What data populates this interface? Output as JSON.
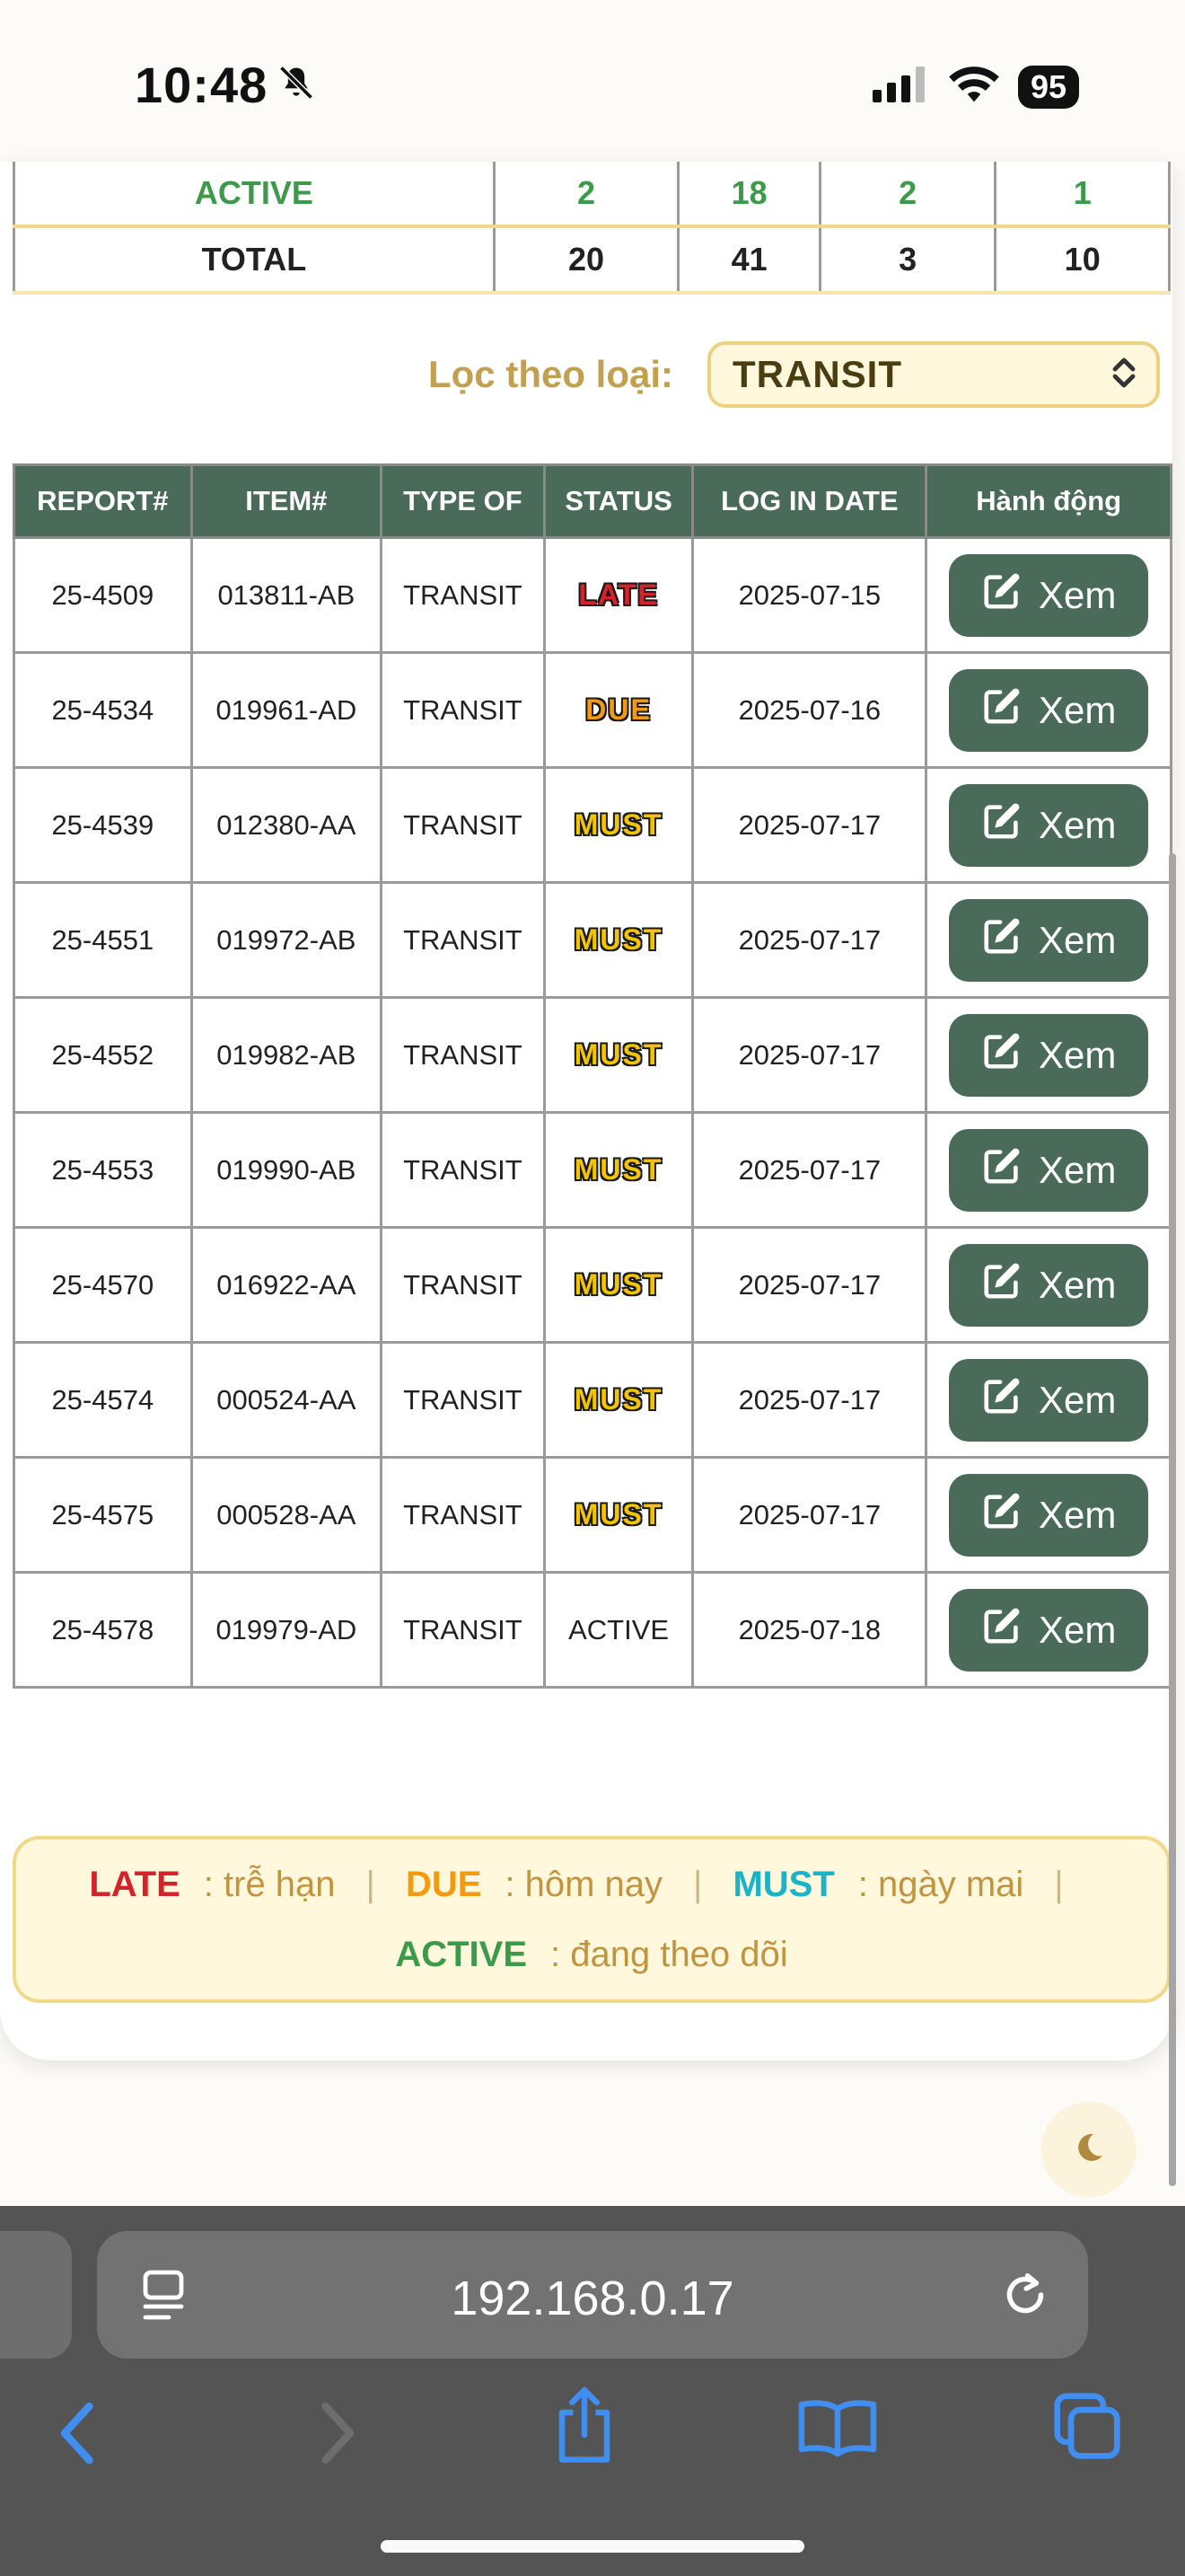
{
  "status_bar": {
    "time": "10:48",
    "battery": "95"
  },
  "summary": {
    "active": {
      "label": "ACTIVE",
      "values": [
        "2",
        "18",
        "2",
        "1"
      ]
    },
    "total": {
      "label": "TOTAL",
      "values": [
        "20",
        "41",
        "3",
        "10"
      ]
    }
  },
  "filter": {
    "label": "Lọc theo loại:",
    "value": "TRANSIT"
  },
  "table": {
    "headers": [
      "REPORT#",
      "ITEM#",
      "TYPE OF",
      "STATUS",
      "LOG IN DATE",
      "Hành động"
    ],
    "rows": [
      {
        "report": "25-4509",
        "item": "013811-AB",
        "type": "TRANSIT",
        "status": "LATE",
        "date": "2025-07-15",
        "action": "Xem"
      },
      {
        "report": "25-4534",
        "item": "019961-AD",
        "type": "TRANSIT",
        "status": "DUE",
        "date": "2025-07-16",
        "action": "Xem"
      },
      {
        "report": "25-4539",
        "item": "012380-AA",
        "type": "TRANSIT",
        "status": "MUST",
        "date": "2025-07-17",
        "action": "Xem"
      },
      {
        "report": "25-4551",
        "item": "019972-AB",
        "type": "TRANSIT",
        "status": "MUST",
        "date": "2025-07-17",
        "action": "Xem"
      },
      {
        "report": "25-4552",
        "item": "019982-AB",
        "type": "TRANSIT",
        "status": "MUST",
        "date": "2025-07-17",
        "action": "Xem"
      },
      {
        "report": "25-4553",
        "item": "019990-AB",
        "type": "TRANSIT",
        "status": "MUST",
        "date": "2025-07-17",
        "action": "Xem"
      },
      {
        "report": "25-4570",
        "item": "016922-AA",
        "type": "TRANSIT",
        "status": "MUST",
        "date": "2025-07-17",
        "action": "Xem"
      },
      {
        "report": "25-4574",
        "item": "000524-AA",
        "type": "TRANSIT",
        "status": "MUST",
        "date": "2025-07-17",
        "action": "Xem"
      },
      {
        "report": "25-4575",
        "item": "000528-AA",
        "type": "TRANSIT",
        "status": "MUST",
        "date": "2025-07-17",
        "action": "Xem"
      },
      {
        "report": "25-4578",
        "item": "019979-AD",
        "type": "TRANSIT",
        "status": "ACTIVE",
        "date": "2025-07-18",
        "action": "Xem"
      }
    ]
  },
  "legend": {
    "late": {
      "key": "LATE",
      "desc": ": trễ hạn",
      "color": "#d4232b"
    },
    "due": {
      "key": "DUE",
      "desc": ": hôm nay",
      "color": "#f49a0e"
    },
    "must": {
      "key": "MUST",
      "desc": ": ngày mai",
      "color": "#1ab3c8"
    },
    "active": {
      "key": "ACTIVE",
      "desc": ": đang theo dõi",
      "color": "#3d9a4a"
    },
    "separator": "|"
  },
  "browser": {
    "url": "192.168.0.17"
  },
  "icons": {
    "mute": "bell-slash-icon",
    "signal": "cellular-signal-icon",
    "wifi": "wifi-icon",
    "edit": "edit-icon",
    "theme": "moon-icon",
    "page": "page-menu-icon",
    "reload": "reload-icon",
    "back": "back-icon",
    "forward": "forward-icon",
    "share": "share-icon",
    "bookmarks": "bookmarks-icon",
    "tabs": "tabs-icon"
  },
  "colors": {
    "accent": "#4a6a5a",
    "gold": "#c2a050"
  }
}
